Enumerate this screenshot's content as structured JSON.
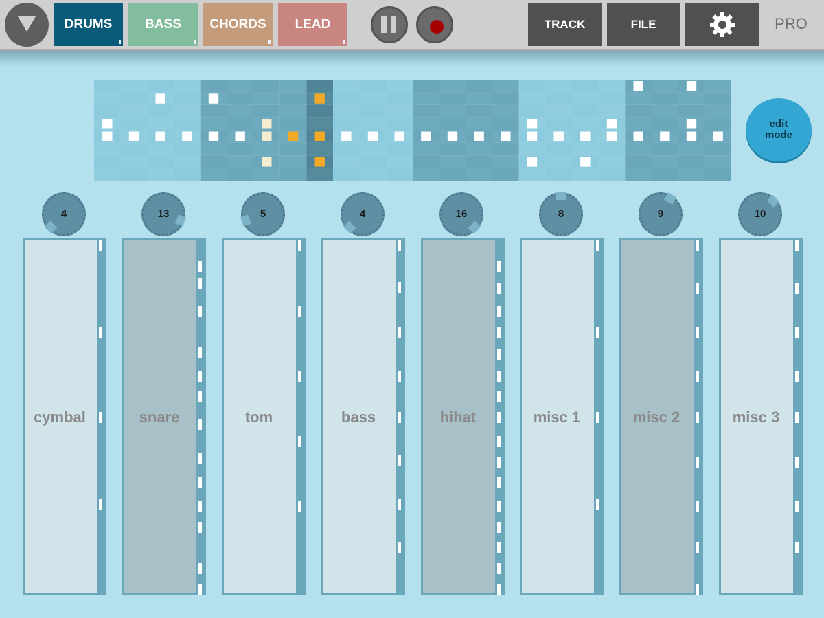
{
  "toolbar": {
    "menu_icon": "triangle-down-icon",
    "tabs": [
      {
        "label": "DRUMS",
        "color": "#0a5b7a"
      },
      {
        "label": "BASS",
        "color": "#82bda0"
      },
      {
        "label": "CHORDS",
        "color": "#c59c7b"
      },
      {
        "label": "LEAD",
        "color": "#c98580"
      }
    ],
    "pause_icon": "pause-icon",
    "record_icon": "record-icon",
    "track_label": "TRACK",
    "file_label": "FILE",
    "settings_icon": "gear-icon",
    "pro_label": "PRO"
  },
  "pattern": {
    "steps": 24,
    "rows": 8,
    "current_step": 8,
    "notes": [
      [
        0,
        21
      ],
      [
        0,
        22
      ],
      [
        0,
        23
      ],
      [
        0,
        27
      ],
      [
        0,
        28
      ],
      [
        0,
        29
      ],
      [
        0,
        33
      ],
      [
        1,
        2
      ],
      [
        1,
        4
      ],
      [
        1,
        8
      ],
      [
        1,
        30
      ],
      [
        2,
        7
      ],
      [
        2,
        8
      ],
      [
        2,
        13
      ],
      [
        2,
        14
      ],
      [
        2,
        19
      ],
      [
        3,
        0
      ],
      [
        3,
        2
      ],
      [
        3,
        3
      ],
      [
        3,
        6
      ],
      [
        3,
        11
      ],
      [
        3,
        12
      ],
      [
        3,
        15
      ],
      [
        3,
        16
      ],
      [
        3,
        20
      ],
      [
        4,
        0
      ],
      [
        4,
        1
      ],
      [
        4,
        2
      ],
      [
        4,
        5
      ],
      [
        4,
        8
      ],
      [
        4,
        9
      ],
      [
        4,
        10
      ],
      [
        5,
        0
      ],
      [
        5,
        1
      ],
      [
        5,
        6
      ],
      [
        6,
        0
      ],
      [
        6,
        3
      ],
      [
        6,
        4
      ],
      [
        6,
        6
      ],
      [
        7,
        0
      ],
      [
        7,
        3
      ],
      [
        7,
        6
      ]
    ],
    "white_cells": [
      [
        0,
        20
      ],
      [
        0,
        22
      ],
      [
        1,
        2
      ],
      [
        1,
        4
      ],
      [
        3,
        0
      ],
      [
        3,
        16
      ],
      [
        3,
        19
      ],
      [
        3,
        22
      ],
      [
        4,
        0
      ],
      [
        4,
        1
      ],
      [
        4,
        2
      ],
      [
        4,
        3
      ],
      [
        4,
        4
      ],
      [
        4,
        5
      ],
      [
        4,
        6
      ],
      [
        4,
        9
      ],
      [
        4,
        10
      ],
      [
        4,
        11
      ],
      [
        4,
        12
      ],
      [
        4,
        13
      ],
      [
        4,
        14
      ],
      [
        4,
        15
      ],
      [
        4,
        16
      ],
      [
        4,
        17
      ],
      [
        4,
        18
      ],
      [
        4,
        19
      ],
      [
        4,
        20
      ],
      [
        4,
        21
      ],
      [
        4,
        22
      ],
      [
        4,
        23
      ],
      [
        6,
        16
      ],
      [
        6,
        18
      ]
    ],
    "cream_cells": [
      [
        3,
        6
      ],
      [
        4,
        6
      ],
      [
        6,
        6
      ],
      [
        4,
        7
      ]
    ],
    "active_cells": [
      [
        1,
        8
      ],
      [
        4,
        8
      ],
      [
        6,
        8
      ],
      [
        4,
        7
      ]
    ],
    "colors": {
      "cell_light": "#8ccbde",
      "cell_dark": "#6aa7bb",
      "note": "#ffffff",
      "cream": "#f6ecd0",
      "active": "#f1a927"
    }
  },
  "edit_mode": {
    "line1": "edit",
    "line2": "mode"
  },
  "instruments": [
    {
      "name": "cymbal",
      "knob_value": "4",
      "shade": "light"
    },
    {
      "name": "snare",
      "knob_value": "13",
      "shade": "dark"
    },
    {
      "name": "tom",
      "knob_value": "5",
      "shade": "light"
    },
    {
      "name": "bass",
      "knob_value": "4",
      "shade": "light"
    },
    {
      "name": "hihat",
      "knob_value": "16",
      "shade": "dark"
    },
    {
      "name": "misc 1",
      "knob_value": "8",
      "shade": "light"
    },
    {
      "name": "misc 2",
      "knob_value": "9",
      "shade": "dark"
    },
    {
      "name": "misc 3",
      "knob_value": "10",
      "shade": "light"
    }
  ]
}
